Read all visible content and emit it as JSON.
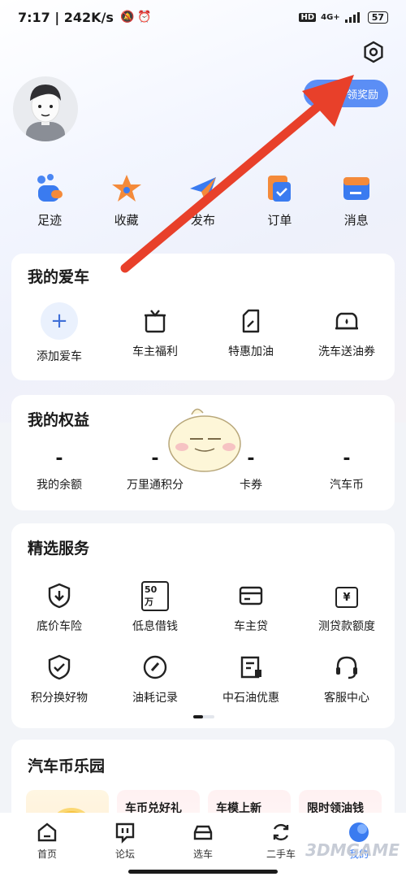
{
  "status_bar": {
    "time_speed": "7:17 | 242K/s",
    "network": "4G+",
    "hd": "HD",
    "battery": "57"
  },
  "header": {
    "reward_label": "领奖励"
  },
  "quick_actions": [
    {
      "label": "足迹",
      "icon": "footprint-icon",
      "color": "#3a7bf0"
    },
    {
      "label": "收藏",
      "icon": "star-icon",
      "color": "#f48a3a"
    },
    {
      "label": "发布",
      "icon": "send-icon",
      "color": "#3a7bf0"
    },
    {
      "label": "订单",
      "icon": "order-icon",
      "color": "#f48a3a"
    },
    {
      "label": "消息",
      "icon": "message-icon",
      "color": "#3a7bf0"
    }
  ],
  "my_car": {
    "title": "我的爱车",
    "items": [
      {
        "label": "添加爱车",
        "icon": "plus-icon"
      },
      {
        "label": "车主福利",
        "icon": "gift-box-icon"
      },
      {
        "label": "特惠加油",
        "icon": "fuel-can-icon"
      },
      {
        "label": "洗车送油券",
        "icon": "car-wash-icon"
      }
    ]
  },
  "my_rights": {
    "title": "我的权益",
    "items": [
      {
        "value": "-",
        "label": "我的余额"
      },
      {
        "value": "-",
        "label": "万里通积分"
      },
      {
        "value": "-",
        "label": "卡券"
      },
      {
        "value": "-",
        "label": "汽车币"
      }
    ]
  },
  "services": {
    "title": "精选服务",
    "row1": [
      {
        "label": "底价车险",
        "icon": "shield-down-icon"
      },
      {
        "label": "低息借钱",
        "icon": "50wan-icon",
        "badge": "50万"
      },
      {
        "label": "车主贷",
        "icon": "card-icon"
      },
      {
        "label": "测贷款额度",
        "icon": "calendar-yen-icon",
        "badge": "¥"
      }
    ],
    "row2": [
      {
        "label": "积分换好物",
        "icon": "shield-check-icon"
      },
      {
        "label": "油耗记录",
        "icon": "gauge-icon"
      },
      {
        "label": "中石油优惠",
        "icon": "coupon-icon"
      },
      {
        "label": "客服中心",
        "icon": "headset-icon"
      }
    ]
  },
  "coin_park": {
    "title": "汽车币乐园",
    "tiles": [
      {
        "label": ""
      },
      {
        "label": "车币兑好礼"
      },
      {
        "label": "车模上新"
      },
      {
        "label": "限时领油钱"
      }
    ]
  },
  "tabbar": [
    {
      "label": "首页",
      "icon": "home-icon"
    },
    {
      "label": "论坛",
      "icon": "forum-icon"
    },
    {
      "label": "选车",
      "icon": "car-select-icon"
    },
    {
      "label": "二手车",
      "icon": "refresh-car-icon"
    },
    {
      "label": "我的",
      "icon": "profile-icon"
    }
  ],
  "watermark": "3DMGAME",
  "colors": {
    "accent": "#5b8ef5",
    "arrow": "#e8402a"
  }
}
